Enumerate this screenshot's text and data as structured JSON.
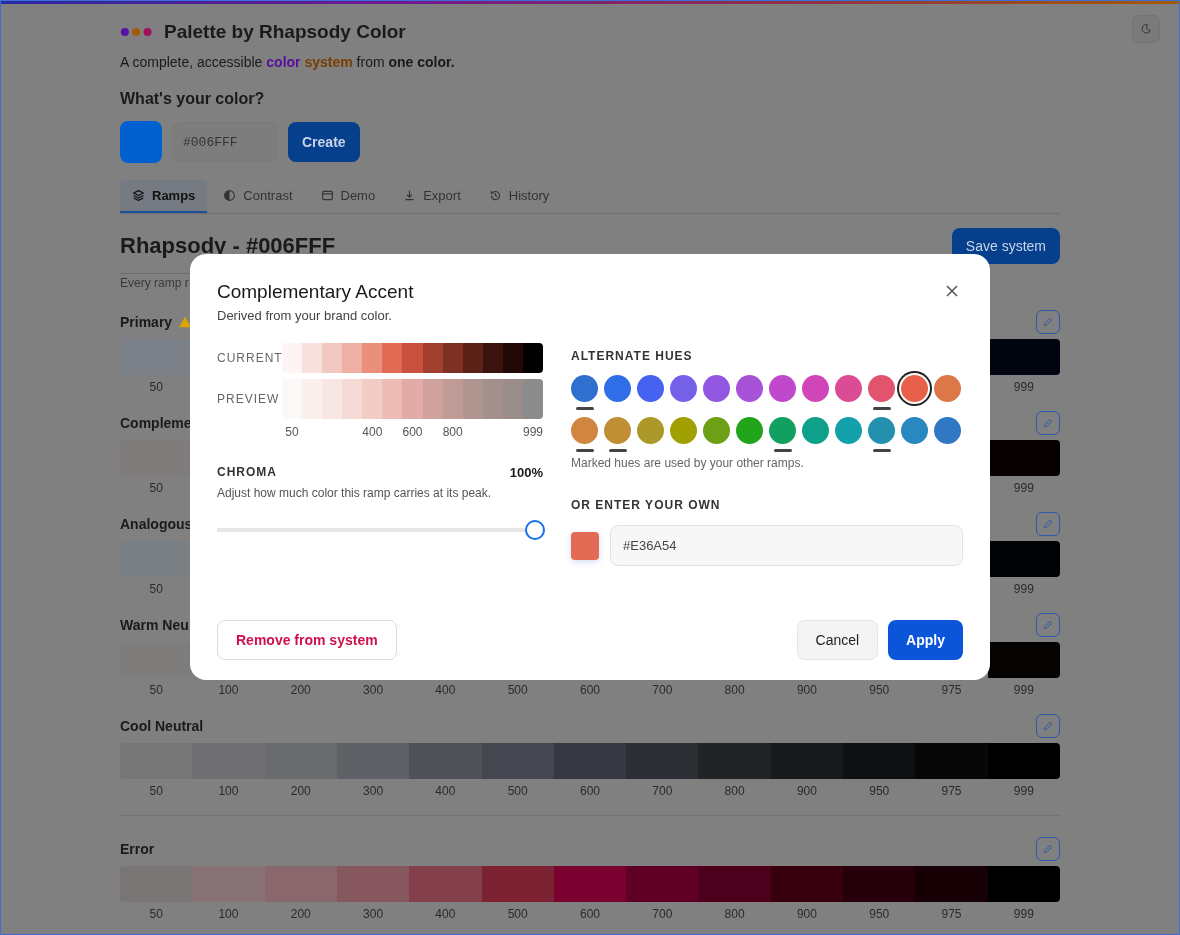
{
  "app": {
    "title": "Palette by Rhapsody Color",
    "tagline": {
      "lead": "A complete, accessible ",
      "highlight_1": "color",
      "highlight_2": " system",
      "middle": " from ",
      "strong": "one color."
    }
  },
  "color_input": {
    "label": "What's your color?",
    "color": "#0060cf",
    "value": "#006FFF",
    "button": "Create"
  },
  "tabs": [
    {
      "label": "Ramps",
      "selected": true
    },
    {
      "label": "Contrast",
      "selected": false
    },
    {
      "label": "Demo",
      "selected": false
    },
    {
      "label": "Export",
      "selected": false
    },
    {
      "label": "History",
      "selected": false
    }
  ],
  "system": {
    "title": "Rhapsody - #006FFF",
    "note": "Every ramp r",
    "save_button": "Save system"
  },
  "ramp_sections": [
    {
      "ramps": [
        {
          "name": "Primary",
          "warning": true,
          "steps": [
            {
              "color": "#7c8089",
              "label": "50"
            },
            {
              "color": "#000510",
              "label": "999"
            }
          ]
        },
        {
          "name": "Compleme",
          "warning": false,
          "steps": [
            {
              "color": "#807c7b",
              "label": "50"
            },
            {
              "color": "#060000",
              "label": "999"
            }
          ]
        },
        {
          "name": "Analogous",
          "warning": false,
          "steps": [
            {
              "color": "#7a7f83",
              "label": "50"
            },
            {
              "color": "#000205",
              "label": "999"
            }
          ]
        },
        {
          "name": "Warm Neu",
          "warning": false,
          "steps": [
            {
              "color": "#7f7d7b",
              "label": "50"
            },
            {
              "label": "100"
            },
            {
              "label": "200"
            },
            {
              "label": "300"
            },
            {
              "label": "400"
            },
            {
              "label": "500"
            },
            {
              "label": "600"
            },
            {
              "label": "700"
            },
            {
              "label": "800"
            },
            {
              "label": "900"
            },
            {
              "label": "950"
            },
            {
              "label": "975"
            },
            {
              "color": "#050403",
              "label": "999"
            }
          ]
        },
        {
          "name": "Cool Neutral",
          "warning": false,
          "steps": [
            {
              "color": "#767676",
              "label": "50"
            },
            {
              "color": "#707072",
              "label": "100"
            },
            {
              "color": "#6a6b6e",
              "label": "200"
            },
            {
              "color": "#5f6166",
              "label": "300"
            },
            {
              "color": "#4f5358",
              "label": "400"
            },
            {
              "color": "#444650",
              "label": "500"
            },
            {
              "color": "#363843",
              "label": "600"
            },
            {
              "color": "#2c2e33",
              "label": "700"
            },
            {
              "color": "#212327",
              "label": "800"
            },
            {
              "color": "#18191c",
              "label": "900"
            },
            {
              "color": "#0e0f10",
              "label": "950"
            },
            {
              "color": "#070708",
              "label": "975"
            },
            {
              "color": "#000000",
              "label": "999"
            }
          ]
        }
      ]
    },
    {
      "ramps": [
        {
          "name": "Error",
          "warning": false,
          "steps": [
            {
              "color": "#797574",
              "label": "50"
            },
            {
              "color": "#877275",
              "label": "100"
            },
            {
              "color": "#8a676c",
              "label": "200"
            },
            {
              "color": "#86575e",
              "label": "300"
            },
            {
              "color": "#833f4a",
              "label": "400"
            },
            {
              "color": "#7c2232",
              "label": "500"
            },
            {
              "color": "#7a0030",
              "label": "600"
            },
            {
              "color": "#600024",
              "label": "700"
            },
            {
              "color": "#4c001c",
              "label": "800"
            },
            {
              "color": "#38000f",
              "label": "900"
            },
            {
              "color": "#25000a",
              "label": "950"
            },
            {
              "color": "#160005",
              "label": "975"
            },
            {
              "color": "#000000",
              "label": "999"
            }
          ]
        }
      ]
    }
  ],
  "dialog": {
    "title": "Complementary Accent",
    "subtitle": "Derived from your brand color.",
    "current": {
      "label": "CURRENT",
      "swatches": [
        {
          "color": "#fdf5f3"
        },
        {
          "color": "#f8e0dd"
        },
        {
          "color": "#f3c8c0"
        },
        {
          "color": "#efb0a3"
        },
        {
          "color": "#e98f7c"
        },
        {
          "color": "#e36a54"
        },
        {
          "color": "#c9513e"
        },
        {
          "color": "#a13f2f"
        },
        {
          "color": "#7e3022"
        },
        {
          "color": "#5c2117"
        },
        {
          "color": "#3b120c"
        },
        {
          "color": "#220806"
        },
        {
          "color": "#000000"
        }
      ]
    },
    "preview": {
      "label": "PREVIEW",
      "swatches": [
        {
          "color": "#fcf8f7",
          "tick": "50"
        },
        {
          "color": "#faf0ee"
        },
        {
          "color": "#f8e6e2"
        },
        {
          "color": "#f5dad5"
        },
        {
          "color": "#f3ccc6",
          "tick": "400"
        },
        {
          "color": "#eebcb5"
        },
        {
          "color": "#e3aba6",
          "tick": "600"
        },
        {
          "color": "#cfa29d"
        },
        {
          "color": "#c09b96",
          "tick": "800"
        },
        {
          "color": "#b0948f"
        },
        {
          "color": "#a38f8b"
        },
        {
          "color": "#9a8c89"
        },
        {
          "color": "#8c8c8c",
          "tick": "999"
        }
      ]
    },
    "chroma": {
      "label": "CHROMA",
      "reading": "100%",
      "description": "Adjust how much color this ramp carries at its peak.",
      "level": 1
    },
    "hues": {
      "label": "ALTERNATE HUES",
      "rows": [
        [
          {
            "color": "#2e6fd0",
            "used": true,
            "selected": false
          },
          {
            "color": "#2f6ee6",
            "used": false,
            "selected": false
          },
          {
            "color": "#4563f0",
            "used": false,
            "selected": false
          },
          {
            "color": "#7560e8",
            "used": false,
            "selected": false
          },
          {
            "color": "#9257e0",
            "used": false,
            "selected": false
          },
          {
            "color": "#a852d8",
            "used": false,
            "selected": false
          },
          {
            "color": "#c048cc",
            "used": false,
            "selected": false
          },
          {
            "color": "#d046b8",
            "used": false,
            "selected": false
          },
          {
            "color": "#dc4c94",
            "used": false,
            "selected": false
          },
          {
            "color": "#e2546e",
            "used": true,
            "selected": false
          },
          {
            "color": "#e8604a",
            "used": false,
            "selected": true
          },
          {
            "color": "#dc7848",
            "used": false,
            "selected": false
          }
        ],
        [
          {
            "color": "#d08540",
            "used": true,
            "selected": false
          },
          {
            "color": "#c08e35",
            "used": true,
            "selected": false
          },
          {
            "color": "#ac9828",
            "used": false,
            "selected": false
          },
          {
            "color": "#a0a000",
            "used": false,
            "selected": false
          },
          {
            "color": "#6ea016",
            "used": false,
            "selected": false
          },
          {
            "color": "#22a41a",
            "used": false,
            "selected": false
          },
          {
            "color": "#12a060",
            "used": true,
            "selected": false
          },
          {
            "color": "#0ea08a",
            "used": false,
            "selected": false
          },
          {
            "color": "#12a0aa",
            "used": false,
            "selected": false
          },
          {
            "color": "#2290ae",
            "used": true,
            "selected": false
          },
          {
            "color": "#2a88c0",
            "used": false,
            "selected": false
          },
          {
            "color": "#3078c4",
            "used": false,
            "selected": false
          }
        ]
      ],
      "note": "Marked hues are used by your other ramps."
    },
    "custom": {
      "label": "OR ENTER YOUR OWN",
      "color": "#e36a54",
      "value": "#E36A54"
    },
    "remove_button": "Remove from system",
    "cancel_button": "Cancel",
    "apply_button": "Apply"
  }
}
